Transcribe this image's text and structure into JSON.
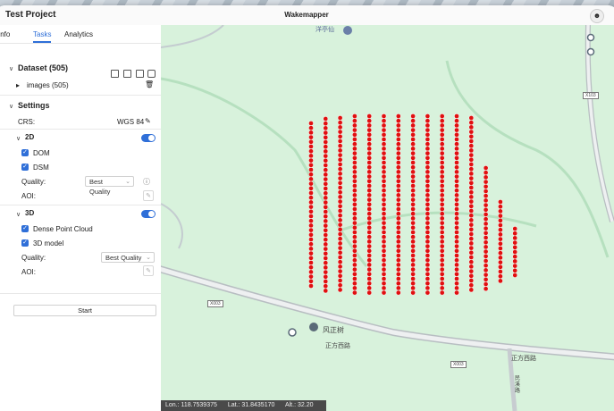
{
  "window": {
    "project_title": "Test Project",
    "app_title": "Wakemapper",
    "user_icon": "user-icon"
  },
  "tabs": [
    {
      "label": "Info",
      "active": false
    },
    {
      "label": "Tasks",
      "active": true
    },
    {
      "label": "Analytics",
      "active": false
    }
  ],
  "dataset": {
    "title": "Dataset (505)",
    "folder": "images (505)"
  },
  "settings": {
    "title": "Settings",
    "crs_label": "CRS:",
    "crs_value": "WGS 84",
    "two_d": {
      "title": "2D",
      "enabled": true,
      "dom_label": "DOM",
      "dsm_label": "DSM",
      "quality_label": "Quality:",
      "quality_value": "Best Quality",
      "aoi_label": "AOI:"
    },
    "three_d": {
      "title": "3D",
      "enabled": true,
      "pointcloud_label": "Dense Point Cloud",
      "model_label": "3D model",
      "quality_label": "Quality:",
      "quality_value": "Best Quality",
      "aoi_label": "AOI:"
    }
  },
  "start_label": "Start",
  "map": {
    "poi_top": "洋亭仙",
    "poi_name": "风正树",
    "road_name_1": "正方西路",
    "road_name_2": "正方西路",
    "road_name_3": "民溪路",
    "road_tag_1": "X103",
    "road_tag_2": "X003",
    "road_tag_3": "X003",
    "marker_color": "#e01010",
    "flight_columns": 15
  },
  "status": {
    "lon": "Lon.: 118.7539375",
    "lat": "Lat.: 31.8435170",
    "alt": "Alt.: 32.20"
  }
}
